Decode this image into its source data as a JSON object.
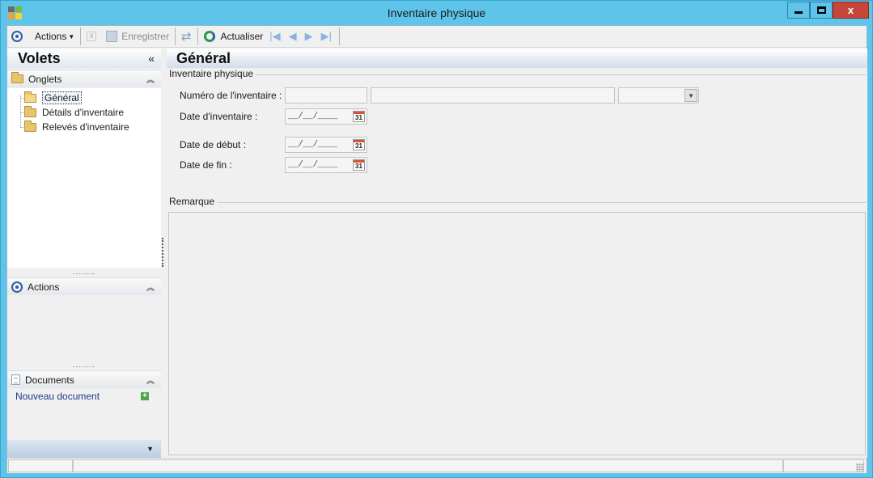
{
  "window": {
    "title": "Inventaire physique",
    "close_glyph": "x"
  },
  "toolbar": {
    "actions_label": "Actions",
    "save_label": "Enregistrer",
    "refresh_label": "Actualiser",
    "delete_glyph": "x"
  },
  "panes": {
    "title": "Volets",
    "collapse_glyph": "«",
    "onglets": {
      "label": "Onglets",
      "items": [
        {
          "label": "Général",
          "selected": true
        },
        {
          "label": "Détails d'inventaire",
          "selected": false
        },
        {
          "label": "Relevés d'inventaire",
          "selected": false
        }
      ]
    },
    "actions": {
      "label": "Actions"
    },
    "documents": {
      "label": "Documents",
      "new_document": "Nouveau document",
      "new_glyph": "+"
    },
    "splitter_glyph": "........"
  },
  "main": {
    "title": "Général",
    "group_inventaire": "Inventaire physique",
    "fields": {
      "numero_label": "Numéro de l'inventaire :",
      "date_inventaire_label": "Date d'inventaire :",
      "date_debut_label": "Date de début :",
      "date_fin_label": "Date de fin :",
      "date_mask": "__/__/____",
      "calendar_day": "31"
    },
    "group_remarque": "Remarque"
  },
  "icons": {
    "actions": "actions-ring-icon",
    "delete": "delete-icon",
    "save": "save-icon",
    "sync": "sync-icon",
    "refresh": "refresh-icon",
    "first": "first-record-icon",
    "prev": "previous-record-icon",
    "next": "next-record-icon",
    "last": "last-record-icon",
    "folder": "folder-icon",
    "calendar": "calendar-icon",
    "document": "document-icon",
    "add": "add-icon"
  }
}
